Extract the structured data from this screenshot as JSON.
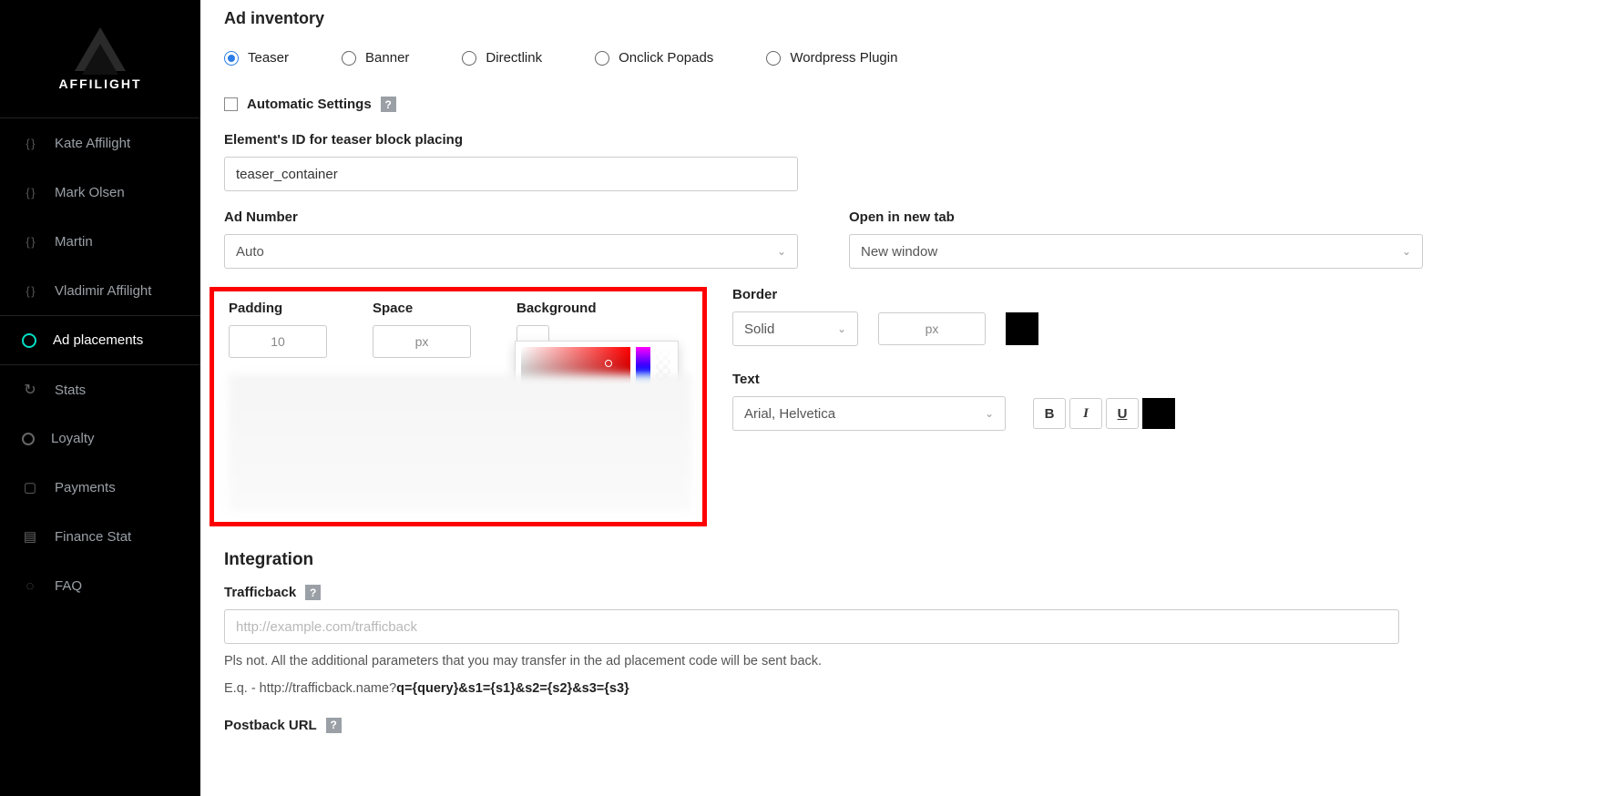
{
  "brand": "AFFILIGHT",
  "sidebar": {
    "users": [
      "Kate Affilight",
      "Mark Olsen",
      "Martin",
      "Vladimir Affilight"
    ],
    "nav": {
      "ad_placements": "Ad placements",
      "stats": "Stats",
      "loyalty": "Loyalty",
      "payments": "Payments",
      "finance_stat": "Finance Stat",
      "faq": "FAQ"
    }
  },
  "page": {
    "title": "Ad inventory",
    "radios": {
      "teaser": "Teaser",
      "banner": "Banner",
      "directlink": "Directlink",
      "onclick": "Onclick Popads",
      "wp": "Wordpress Plugin"
    },
    "auto_settings": "Automatic Settings",
    "el_id_label": "Element's ID for teaser block placing",
    "el_id_value": "teaser_container",
    "ad_number_label": "Ad Number",
    "ad_number_value": "Auto",
    "open_tab_label": "Open in new tab",
    "open_tab_value": "New window",
    "padding_label": "Padding",
    "padding_value": "10",
    "space_label": "Space",
    "space_value": "px",
    "background_label": "Background",
    "border_label": "Border",
    "border_style": "Solid",
    "border_px": "px",
    "text_label": "Text",
    "font_value": "Arial, Helvetica",
    "text_b": "B",
    "text_i": "I",
    "text_u": "U",
    "integration_title": "Integration",
    "trafficback_label": "Trafficback",
    "trafficback_placeholder": "http://example.com/trafficback",
    "note_line1": "Pls not. All the additional parameters that you may transfer in the ad placement code will be sent back.",
    "note_line2a": "E.q. - http://trafficback.name?",
    "note_line2b": "q={query}&s1={s1}&s2={s2}&s3={s3}",
    "postback_label": "Postback URL"
  }
}
